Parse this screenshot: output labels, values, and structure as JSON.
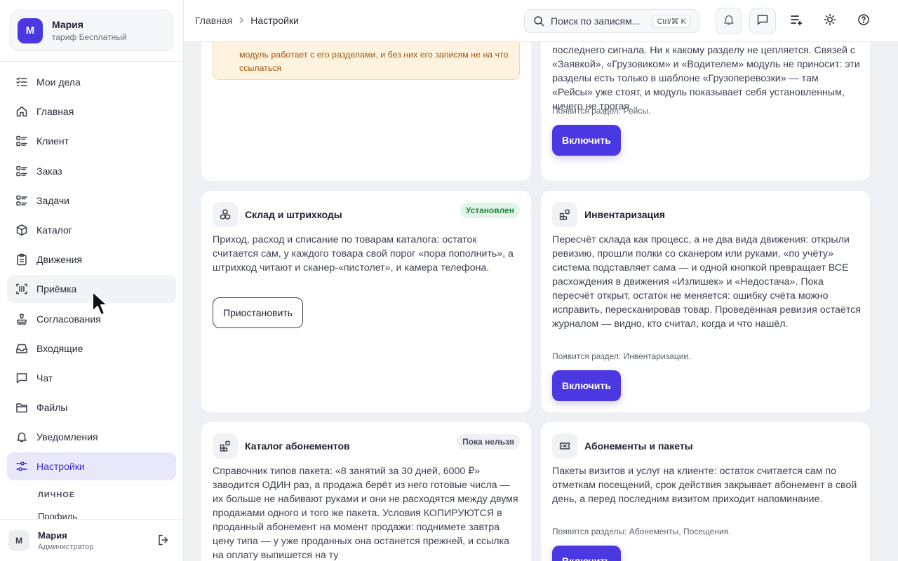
{
  "account": {
    "initial": "М",
    "name": "Мария",
    "plan": "тариф Бесплатный"
  },
  "nav": {
    "items": [
      {
        "label": "Мои дела",
        "icon": "checklist-icon"
      },
      {
        "label": "Главная",
        "icon": "home-icon"
      },
      {
        "label": "Клиент",
        "icon": "list-icon"
      },
      {
        "label": "Заказ",
        "icon": "list-icon"
      },
      {
        "label": "Задачи",
        "icon": "list-icon"
      },
      {
        "label": "Каталог",
        "icon": "box-icon"
      },
      {
        "label": "Движения",
        "icon": "clipboard-icon"
      },
      {
        "label": "Приёмка",
        "icon": "barcode-scan-icon"
      },
      {
        "label": "Согласования",
        "icon": "stamp-icon"
      },
      {
        "label": "Входящие",
        "icon": "inbox-icon"
      },
      {
        "label": "Чат",
        "icon": "chat-icon"
      },
      {
        "label": "Файлы",
        "icon": "folder-icon"
      },
      {
        "label": "Уведомления",
        "icon": "bell-icon"
      },
      {
        "label": "Настройки",
        "icon": "sliders-icon"
      }
    ],
    "section_label": "ЛИЧНОЕ",
    "sub_item": "Профиль"
  },
  "user": {
    "initial": "М",
    "name": "Мария",
    "role": "Администратор"
  },
  "breadcrumb": {
    "home": "Главная",
    "current": "Настройки"
  },
  "search": {
    "placeholder": "Поиск по записям...",
    "shortcut": "Ctrl/⌘ K"
  },
  "cards": {
    "top_left_warning": "модуль работает с его разделами, и без них его записям не на что ссылаться",
    "top_right": {
      "description": "последнего сигнала. Ни к какому разделу не цепляется. Связей с «Заявкой», «Грузовиком» и «Водителем» модуль не приносит: эти разделы есть только в шаблоне «Грузоперевозки» — там «Рейсы» уже стоят, и модуль показывает себя установленным, ничего не трогая.",
      "note": "Появится раздел: Рейсы.",
      "button": "Включить"
    },
    "warehouse": {
      "title": "Склад и штрихкоды",
      "badge": "Установлен",
      "description": "Приход, расход и списание по товарам каталога: остаток считается сам, у каждого товара свой порог «пора пополнить», а штрихкод читают и сканер-«пистолет», и камера телефона.",
      "button": "Приостановить"
    },
    "inventory": {
      "title": "Инвентаризация",
      "description": "Пересчёт склада как процесс, а не два вида движения: открыли ревизию, прошли полки со сканером или руками, «по учёту» система подставляет сама — и одной кнопкой превращает ВСЕ расхождения в движения «Излишек» и «Недостача». Пока пересчёт открыт, остаток не меняется: ошибку счёта можно исправить, пересканировав товар. Проведённая ревизия остаётся журналом — видно, кто считал, когда и что нашёл.",
      "note": "Появится раздел: Инвентаризации.",
      "button": "Включить"
    },
    "subs_catalog": {
      "title": "Каталог абонементов",
      "badge": "Пока нельзя",
      "description": "Справочник типов пакета: «8 занятий за 30 дней, 6000 ₽» заводится ОДИН раз, а продажа берёт из него готовые числа — их больше не набивают руками и они не расходятся между двумя продажами одного и того же пакета. Условия КОПИРУЮТСЯ в проданный абонемент на момент продажи: поднимете завтра цену типа — у уже проданных она останется прежней, и ссылка на оплату выпишется на ту"
    },
    "subs_packages": {
      "title": "Абонементы и пакеты",
      "description": "Пакеты визитов и услуг на клиенте: остаток считается сам по отметкам посещений, срок действия закрывает абонемент в свой день, а перед последним визитом приходит напоминание.",
      "note": "Появятся разделы: Абонементы, Посещения.",
      "button": "Включить"
    }
  }
}
